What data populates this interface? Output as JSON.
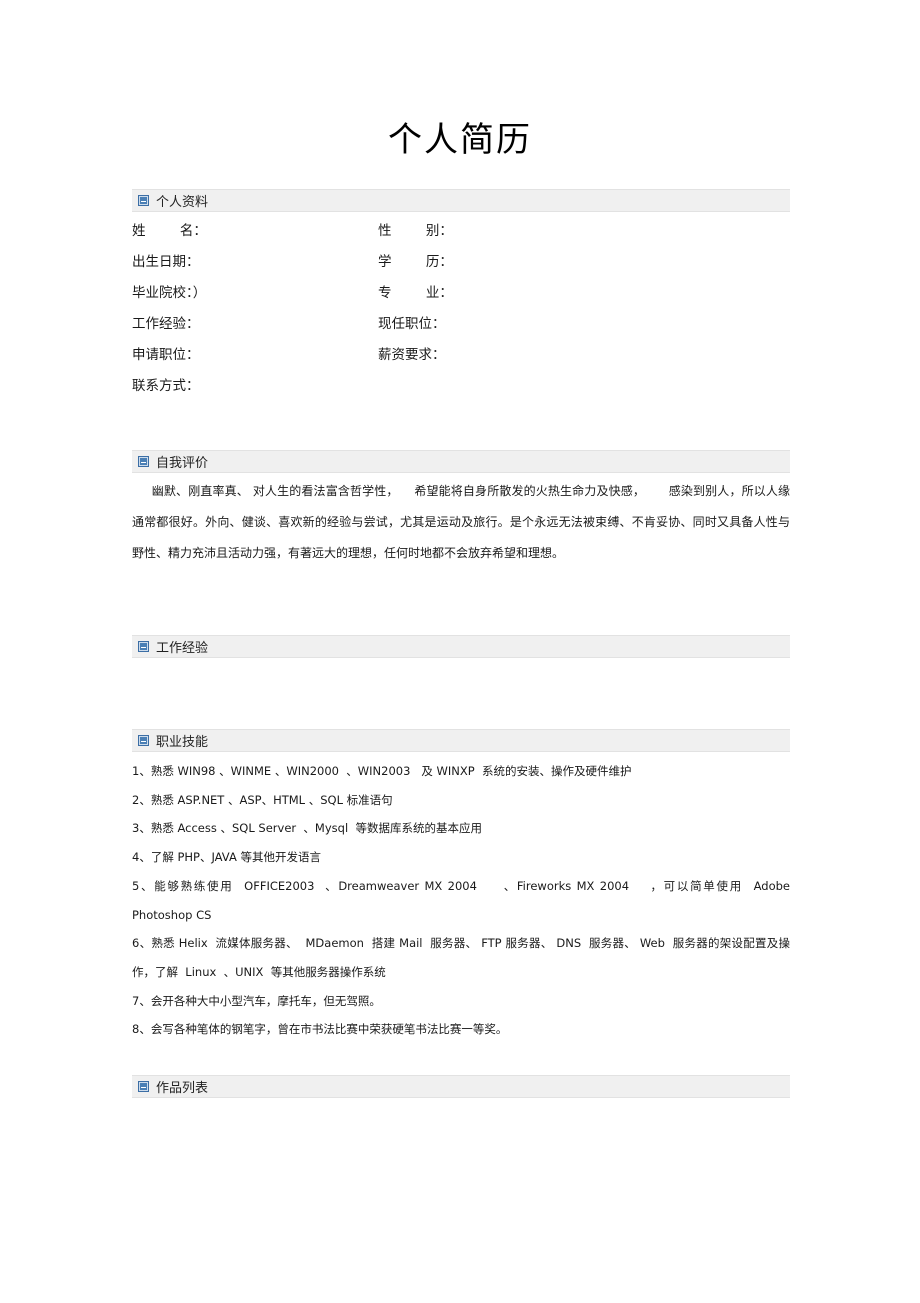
{
  "document": {
    "title": "个人简历"
  },
  "theme": {
    "section_bar_bg": "#f0f0f0",
    "section_bar_border": "#e2e2e2",
    "icon_blue": "#4a7fb5",
    "text_color": "#1a1a1a",
    "page_bg": "#ffffff"
  },
  "sections": {
    "personal_info": {
      "heading": "个人资料",
      "icon": "broken-image-icon",
      "rows": [
        {
          "left": "姓        名：",
          "right": "性        别："
        },
        {
          "left": "出生日期：",
          "right": "学        历："
        },
        {
          "left": "毕业院校：）",
          "right": "专        业："
        },
        {
          "left": "工作经验：",
          "right": "现任职位："
        },
        {
          "left": "申请职位：",
          "right": "薪资要求："
        },
        {
          "left": "联系方式：",
          "right": ""
        }
      ]
    },
    "self_evaluation": {
      "heading": "自我评价",
      "icon": "broken-image-icon",
      "paragraph": "     幽默、刚直率真、 对人生的看法富含哲学性，    希望能将自身所散发的火热生命力及快感，      感染到别人，所以人缘通常都很好。外向、健谈、喜欢新的经验与尝试，尤其是运动及旅行。是个永远无法被束缚、不肯妥协、同时又具备人性与野性、精力充沛且活动力强，有著远大的理想，任何时地都不会放弃希望和理想。"
    },
    "work_experience": {
      "heading": "工作经验",
      "icon": "broken-image-icon",
      "content": ""
    },
    "professional_skills": {
      "heading": "职业技能",
      "icon": "broken-image-icon",
      "items": [
        "1、熟悉 WIN98 、WINME 、WIN2000  、WIN2003   及 WINXP  系统的安装、操作及硬件维护",
        "2、熟悉 ASP.NET 、ASP、HTML 、SQL 标准语句",
        "3、熟悉 Access 、SQL Server  、Mysql  等数据库系统的基本应用",
        "4、了解 PHP、JAVA 等其他开发语言",
        "5、能够熟练使用  OFFICE2003  、Dreamweaver MX 2004     、Fireworks MX 2004    ，可以简单使用  Adobe Photoshop CS",
        "6、熟悉 Helix  流媒体服务器、  MDaemon  搭建 Mail  服务器、 FTP 服务器、 DNS  服务器、 Web  服务器的架设配置及操作，了解  Linux  、UNIX  等其他服务器操作系统",
        "7、会开各种大中小型汽车，摩托车，但无驾照。",
        "8、会写各种笔体的钢笔字，曾在市书法比赛中荣获硬笔书法比赛一等奖。"
      ]
    },
    "portfolio": {
      "heading": "作品列表",
      "icon": "broken-image-icon",
      "content": ""
    }
  }
}
